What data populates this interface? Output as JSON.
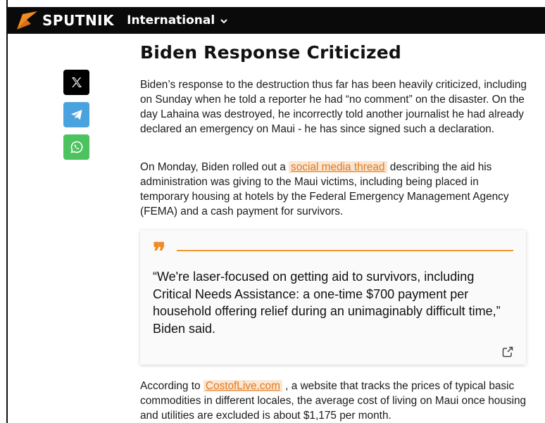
{
  "header": {
    "logo_text": "SPUTNIK",
    "edition_label": "International"
  },
  "share": {
    "icons": [
      "x-icon",
      "telegram-icon",
      "whatsapp-icon"
    ]
  },
  "article": {
    "headline": "Biden Response Criticized",
    "p1": "Biden’s response to the destruction thus far has been heavily criticized, including on Sunday when he told a reporter he had “no comment” on the disaster. On the day Lahaina was destroyed, he incorrectly told another journalist he had already declared an emergency on Maui - he has since signed such a declaration.",
    "p2_before": "On Monday, Biden rolled out a ",
    "p2_link": "social media thread",
    "p2_after": " describing the aid his administration was giving to the Maui victims, including being placed in temporary housing at hotels by the Federal Emergency Management Agency (FEMA) and a cash payment for survivors.",
    "quote": "“We're laser-focused on getting aid to survivors, including Critical Needs Assistance: a one-time $700 payment per household offering relief during an unimaginably difficult time,” Biden said.",
    "p3_before": "According to ",
    "p3_link": "CostofLive.com",
    "p3_after": " , a website that tracks the prices of typical basic commodities in different locales, the average cost of living on Maui once housing and utilities are excluded is about $1,175 per month."
  },
  "colors": {
    "accent": "#f08a24",
    "link_bg": "#fbe6d2",
    "telegram": "#4aa3df",
    "whatsapp": "#4cc35e"
  }
}
